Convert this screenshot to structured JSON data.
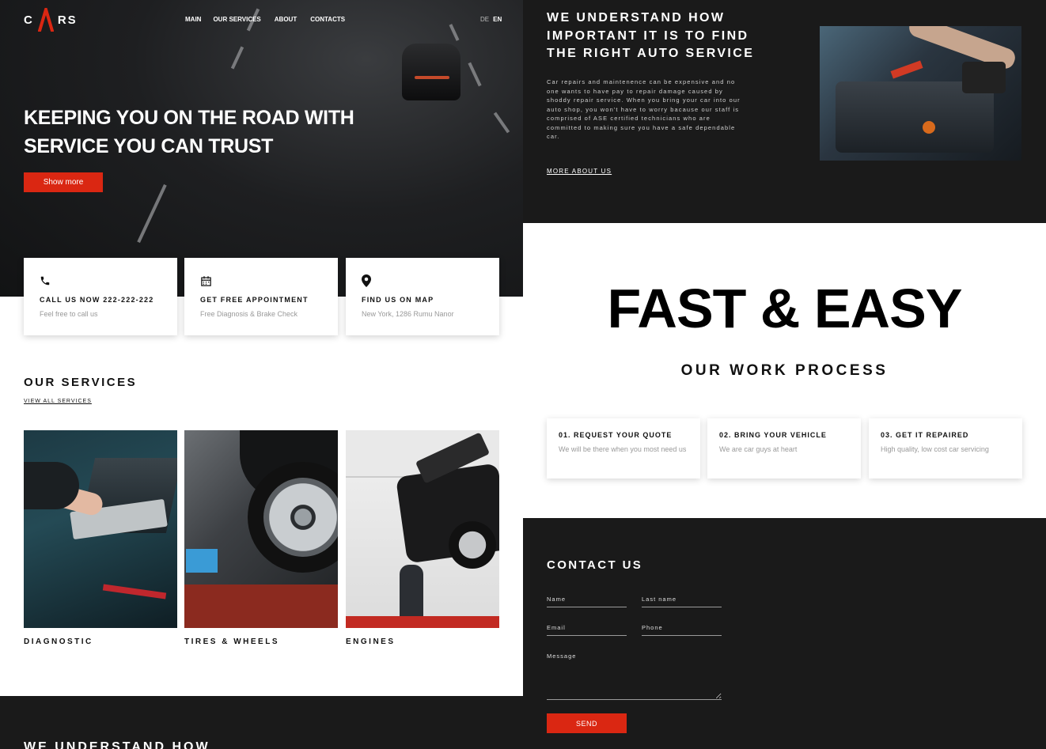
{
  "brand": {
    "logo_letters": [
      "C",
      "RS"
    ],
    "accent_color": "#da2712"
  },
  "nav": {
    "items": [
      "MAIN",
      "OUR SERVICES",
      "ABOUT",
      "CONTACTS"
    ]
  },
  "lang": {
    "de": "DE",
    "en": "EN"
  },
  "hero": {
    "title_line1": "KEEPING YOU ON THE ROAD WITH",
    "title_line2": "SERVICE YOU CAN TRUST",
    "button": "Show more"
  },
  "info_cards": [
    {
      "icon": "phone-icon",
      "title": "CALL US NOW 222-222-222",
      "subtitle": "Feel free to call us"
    },
    {
      "icon": "calendar-icon",
      "title": "GET FREE APPOINTMENT",
      "subtitle": "Free Diagnosis & Brake Check"
    },
    {
      "icon": "map-pin-icon",
      "title": "FIND US ON MAP",
      "subtitle": "New York, 1286 Rumu Nanor"
    }
  ],
  "services": {
    "title": "OUR SERVICES",
    "link": "VIEW ALL SERVICES",
    "items": [
      {
        "name": "DIAGNOSTIC"
      },
      {
        "name": "TIRES & WHEELS"
      },
      {
        "name": "ENGINES"
      }
    ]
  },
  "strip_peek": "WE UNDERSTAND HOW",
  "about": {
    "title": "WE UNDERSTAND HOW IMPORTANT IT IS TO FIND THE RIGHT AUTO SERVICE",
    "text": "Car repairs and maintenence can be expensive and no one wants to have pay to repair damage caused by shoddy repair service. When you bring your car into our auto shop, you won't have to worry bacause our staff is comprised of ASE certified technicians who are committed to making sure you have a safe dependable car.",
    "link": "MORE ABOUT US"
  },
  "process": {
    "headline": "FAST & EASY",
    "subtitle": "OUR WORK PROCESS",
    "steps": [
      {
        "title": "01. REQUEST YOUR QUOTE",
        "desc": "We will be there when you most need us"
      },
      {
        "title": "02. BRING YOUR VEHICLE",
        "desc": "We are car guys at heart"
      },
      {
        "title": "03. GET IT REPAIRED",
        "desc": "High quality, low cost car servicing"
      }
    ]
  },
  "contact": {
    "title": "CONTACT US",
    "name_placeholder": "Name",
    "lastname_placeholder": "Last name",
    "email_placeholder": "Email",
    "phone_placeholder": "Phone",
    "message_placeholder": "Message",
    "send": "SEND"
  }
}
